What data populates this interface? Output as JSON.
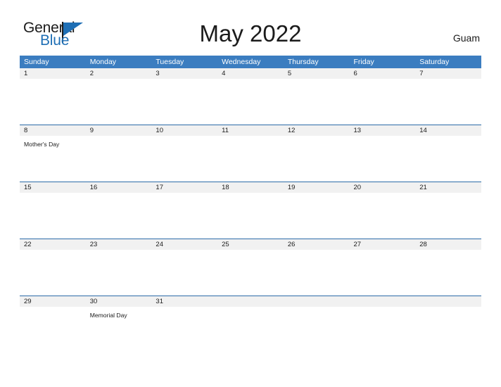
{
  "brand": {
    "name_part1": "General",
    "name_part2": "Blue",
    "logo_icon": "blue-flag-triangle-icon",
    "color_dark": "#1b1b1b",
    "color_blue": "#1f6fb5"
  },
  "header": {
    "title": "May 2022",
    "locale": "Guam"
  },
  "calendar": {
    "header_bg": "#3b7dc0",
    "row_divider": "#2c6ba8",
    "number_strip_bg": "#f1f1f1",
    "weekdays": [
      "Sunday",
      "Monday",
      "Tuesday",
      "Wednesday",
      "Thursday",
      "Friday",
      "Saturday"
    ],
    "weeks": [
      {
        "days": [
          {
            "number": "1",
            "events": []
          },
          {
            "number": "2",
            "events": []
          },
          {
            "number": "3",
            "events": []
          },
          {
            "number": "4",
            "events": []
          },
          {
            "number": "5",
            "events": []
          },
          {
            "number": "6",
            "events": []
          },
          {
            "number": "7",
            "events": []
          }
        ]
      },
      {
        "days": [
          {
            "number": "8",
            "events": [
              "Mother's Day"
            ]
          },
          {
            "number": "9",
            "events": []
          },
          {
            "number": "10",
            "events": []
          },
          {
            "number": "11",
            "events": []
          },
          {
            "number": "12",
            "events": []
          },
          {
            "number": "13",
            "events": []
          },
          {
            "number": "14",
            "events": []
          }
        ]
      },
      {
        "days": [
          {
            "number": "15",
            "events": []
          },
          {
            "number": "16",
            "events": []
          },
          {
            "number": "17",
            "events": []
          },
          {
            "number": "18",
            "events": []
          },
          {
            "number": "19",
            "events": []
          },
          {
            "number": "20",
            "events": []
          },
          {
            "number": "21",
            "events": []
          }
        ]
      },
      {
        "days": [
          {
            "number": "22",
            "events": []
          },
          {
            "number": "23",
            "events": []
          },
          {
            "number": "24",
            "events": []
          },
          {
            "number": "25",
            "events": []
          },
          {
            "number": "26",
            "events": []
          },
          {
            "number": "27",
            "events": []
          },
          {
            "number": "28",
            "events": []
          }
        ]
      },
      {
        "days": [
          {
            "number": "29",
            "events": []
          },
          {
            "number": "30",
            "events": [
              "Memorial Day"
            ]
          },
          {
            "number": "31",
            "events": []
          },
          {
            "number": "",
            "events": []
          },
          {
            "number": "",
            "events": []
          },
          {
            "number": "",
            "events": []
          },
          {
            "number": "",
            "events": []
          }
        ]
      }
    ]
  }
}
